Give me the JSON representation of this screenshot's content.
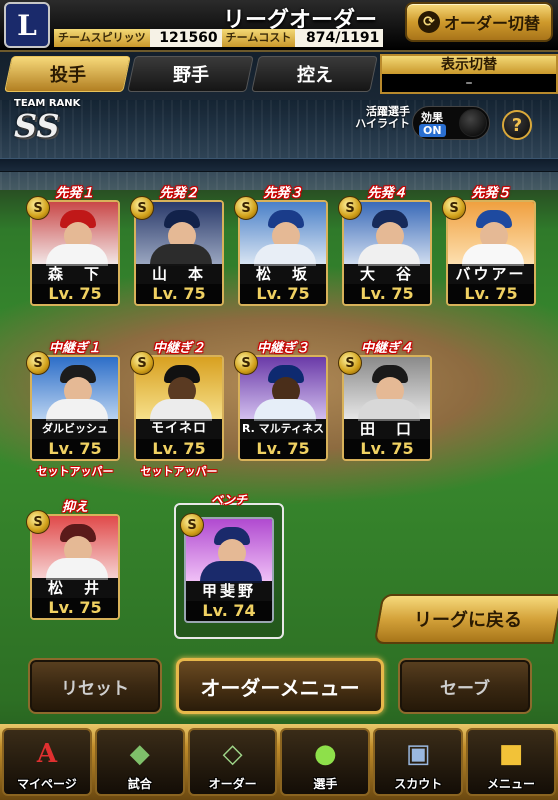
{
  "header": {
    "title": "リーグオーダー",
    "team_logo_letter": "L",
    "team_spirit_label": "チームスピリッツ",
    "team_spirit_value": "121560",
    "team_cost_label": "チームコスト",
    "team_cost_value": "874/1191",
    "order_switch_label": "オーダー切替"
  },
  "tabs": [
    {
      "label": "投手",
      "active": true
    },
    {
      "label": "野手",
      "active": false
    },
    {
      "label": "控え",
      "active": false
    }
  ],
  "display_toggle": {
    "title": "表示切替",
    "value": "–"
  },
  "team_rank": {
    "label": "TEAM RANK",
    "value": "SS"
  },
  "highlight": {
    "label_line1": "活躍選手",
    "label_line2": "ハイライト",
    "effect_label": "効果",
    "effect_state": "ON"
  },
  "help_label": "?",
  "starters": [
    {
      "role": "先発１",
      "name": "森　下",
      "level": "Lv. 75",
      "rarity": "S"
    },
    {
      "role": "先発２",
      "name": "山　本",
      "level": "Lv. 75",
      "rarity": "S"
    },
    {
      "role": "先発３",
      "name": "松　坂",
      "level": "Lv. 75",
      "rarity": "S"
    },
    {
      "role": "先発４",
      "name": "大　谷",
      "level": "Lv. 75",
      "rarity": "S"
    },
    {
      "role": "先発５",
      "name": "バウアー",
      "level": "Lv. 75",
      "rarity": "S"
    }
  ],
  "relievers": [
    {
      "role": "中継ぎ１",
      "name": "ダルビッシュ",
      "level": "Lv. 75",
      "rarity": "S",
      "subrole": "セットアッパー"
    },
    {
      "role": "中継ぎ２",
      "name": "モイネロ",
      "level": "Lv. 75",
      "rarity": "S",
      "subrole": "セットアッパー"
    },
    {
      "role": "中継ぎ３",
      "name": "R. マルティネス",
      "level": "Lv. 75",
      "rarity": "S"
    },
    {
      "role": "中継ぎ４",
      "name": "田　口",
      "level": "Lv. 75",
      "rarity": "S"
    }
  ],
  "closer": {
    "role": "抑え",
    "name": "松　井",
    "level": "Lv. 75",
    "rarity": "S"
  },
  "bench": {
    "label": "ベンチ",
    "name": "甲斐野",
    "level": "Lv. 74",
    "rarity": "S"
  },
  "buttons": {
    "back_to_league": "リーグに戻る",
    "reset": "リセット",
    "order_menu": "オーダーメニュー",
    "save": "セーブ"
  },
  "bottom_nav": [
    {
      "label": "マイページ",
      "icon": "mypage-icon"
    },
    {
      "label": "試合",
      "icon": "game-icon"
    },
    {
      "label": "オーダー",
      "icon": "order-icon"
    },
    {
      "label": "選手",
      "icon": "player-icon"
    },
    {
      "label": "スカウト",
      "icon": "scout-icon"
    },
    {
      "label": "メニュー",
      "icon": "menu-icon"
    }
  ],
  "colors": {
    "accent_gold": "#d4a23a",
    "role_red": "#cc0000",
    "level_yellow": "#f0d162"
  }
}
